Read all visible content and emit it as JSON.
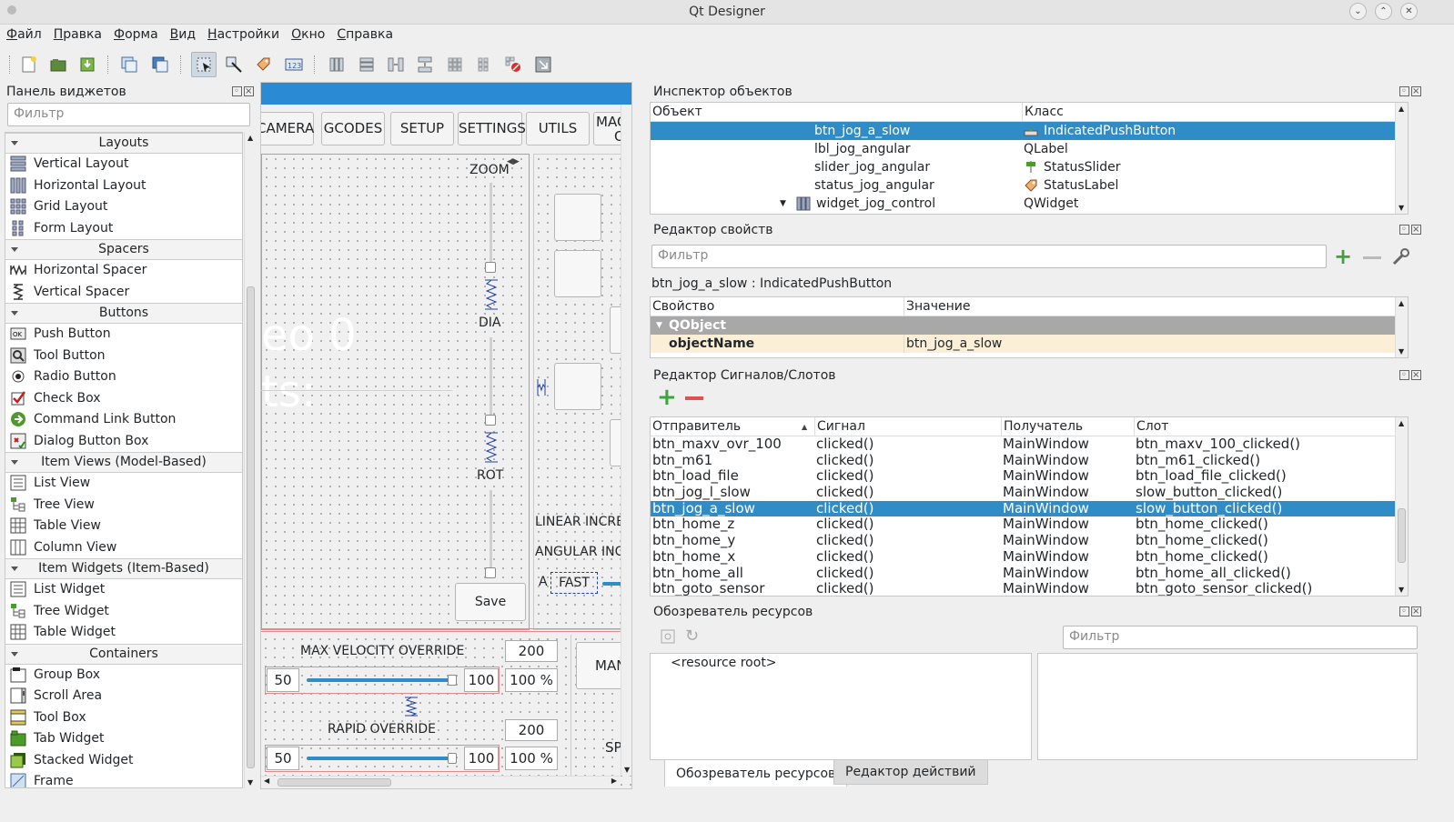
{
  "window": {
    "title": "Qt Designer"
  },
  "menu": [
    "Файл",
    "Правка",
    "Форма",
    "Вид",
    "Настройки",
    "Окно",
    "Справка"
  ],
  "widgetbox": {
    "title": "Панель виджетов",
    "filter_placeholder": "Фильтр",
    "groups": [
      {
        "name": "Layouts",
        "items": [
          "Vertical Layout",
          "Horizontal Layout",
          "Grid Layout",
          "Form Layout"
        ]
      },
      {
        "name": "Spacers",
        "items": [
          "Horizontal Spacer",
          "Vertical Spacer"
        ]
      },
      {
        "name": "Buttons",
        "items": [
          "Push Button",
          "Tool Button",
          "Radio Button",
          "Check Box",
          "Command Link Button",
          "Dialog Button Box"
        ]
      },
      {
        "name": "Item Views (Model-Based)",
        "items": [
          "List View",
          "Tree View",
          "Table View",
          "Column View"
        ]
      },
      {
        "name": "Item Widgets (Item-Based)",
        "items": [
          "List Widget",
          "Tree Widget",
          "Table Widget"
        ]
      },
      {
        "name": "Containers",
        "items": [
          "Group Box",
          "Scroll Area",
          "Tool Box",
          "Tab Widget",
          "Stacked Widget",
          "Frame"
        ]
      }
    ]
  },
  "form": {
    "tabs": [
      "CAMERA",
      "GCODES",
      "SETUP",
      "SETTINGS",
      "UTILS",
      "MACH",
      "OF"
    ],
    "zoom": "ZOOM",
    "dia": "DIA",
    "rot": "ROT",
    "save": "Save",
    "bg_text1": "eo 0",
    "bg_text2": "ts:",
    "linear_incr": "LINEAR INCREI",
    "angular_incr": "ANGULAR INCR",
    "a_label": "A",
    "fast_label": "FAST",
    "max_vel": "MAX VELOCITY OVERRIDE",
    "max_vel_max": "200",
    "max_vel_min": "50",
    "max_vel_cur": "100",
    "max_vel_pct": "100 %",
    "max_vel_slider": 1.0,
    "rapid": "RAPID OVERRIDE",
    "rapid_max": "200",
    "rapid_min": "50",
    "rapid_cur": "100",
    "rapid_pct": "100 %",
    "rapid_slider": 1.0,
    "man": "MAN",
    "spin": "SPIN"
  },
  "inspector": {
    "title": "Инспектор объектов",
    "col_object": "Объект",
    "col_class": "Класс",
    "rows": [
      {
        "object": "btn_jog_a_slow",
        "class": "IndicatedPushButton",
        "selected": true
      },
      {
        "object": "lbl_jog_angular",
        "class": "QLabel",
        "selected": false
      },
      {
        "object": "slider_jog_angular",
        "class": "StatusSlider",
        "selected": false
      },
      {
        "object": "status_jog_angular",
        "class": "StatusLabel",
        "selected": false
      },
      {
        "object": "widget_jog_control",
        "class": "QWidget",
        "selected": false
      }
    ]
  },
  "props": {
    "title": "Редактор свойств",
    "filter_placeholder": "Фильтр",
    "object_line": "btn_jog_a_slow : IndicatedPushButton",
    "col_prop": "Свойство",
    "col_value": "Значение",
    "group": "QObject",
    "prop_name": "objectName",
    "prop_value": "btn_jog_a_slow"
  },
  "sigslot": {
    "title": "Редактор Сигналов/Слотов",
    "cols": [
      "Отправитель",
      "Сигнал",
      "Получатель",
      "Слот"
    ],
    "rows": [
      [
        "btn_maxv_ovr_100",
        "clicked()",
        "MainWindow",
        "btn_maxv_100_clicked()"
      ],
      [
        "btn_m61",
        "clicked()",
        "MainWindow",
        "btn_m61_clicked()"
      ],
      [
        "btn_load_file",
        "clicked()",
        "MainWindow",
        "btn_load_file_clicked()"
      ],
      [
        "btn_jog_l_slow",
        "clicked()",
        "MainWindow",
        "slow_button_clicked()"
      ],
      [
        "btn_jog_a_slow",
        "clicked()",
        "MainWindow",
        "slow_button_clicked()"
      ],
      [
        "btn_home_z",
        "clicked()",
        "MainWindow",
        "btn_home_clicked()"
      ],
      [
        "btn_home_y",
        "clicked()",
        "MainWindow",
        "btn_home_clicked()"
      ],
      [
        "btn_home_x",
        "clicked()",
        "MainWindow",
        "btn_home_clicked()"
      ],
      [
        "btn_home_all",
        "clicked()",
        "MainWindow",
        "btn_home_all_clicked()"
      ],
      [
        "btn_goto_sensor",
        "clicked()",
        "MainWindow",
        "btn_goto_sensor_clicked()"
      ]
    ],
    "selected_index": 4
  },
  "resources": {
    "title": "Обозреватель ресурсов",
    "filter_placeholder": "Фильтр",
    "root": "<resource root>",
    "tab_res": "Обозреватель ресурсов",
    "tab_actions": "Редактор действий"
  },
  "colors": {
    "accent": "#308cc6",
    "form_blue": "#2a8ad4"
  }
}
